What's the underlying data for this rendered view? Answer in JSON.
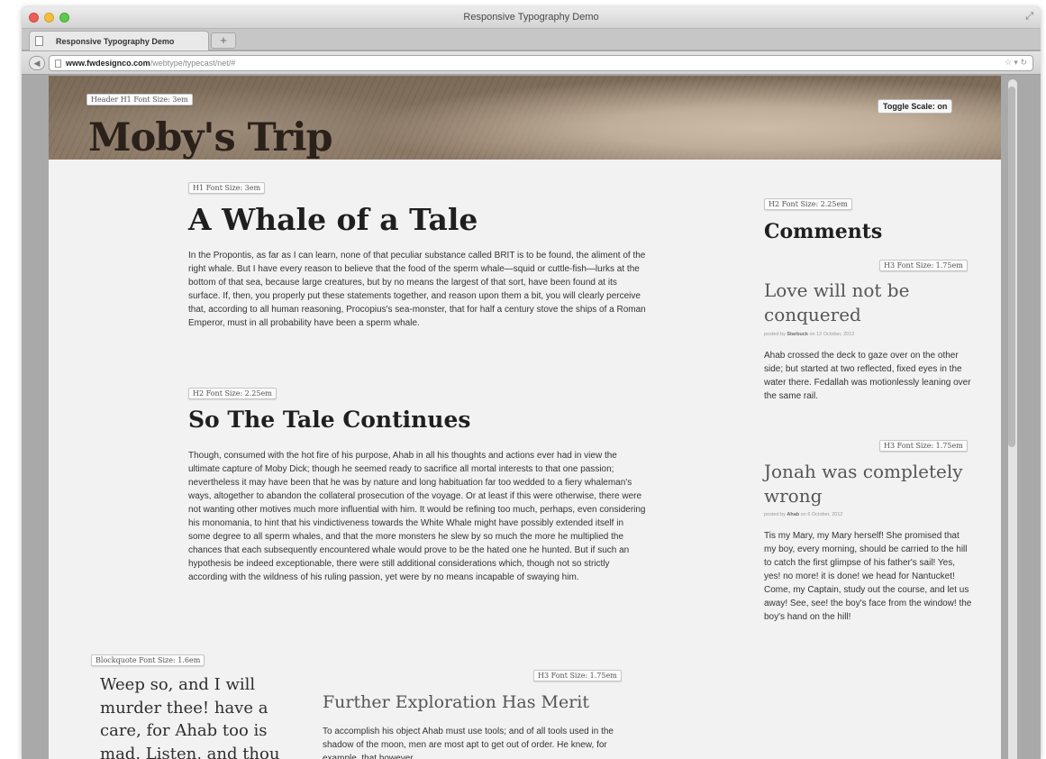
{
  "browser": {
    "window_title": "Responsive Typography Demo",
    "tab_label": "Responsive Typography Demo",
    "new_tab_label": "+",
    "url_domain": "www.fwdesignco.com",
    "url_path": "/webtype/typecast/net/#"
  },
  "header": {
    "title": "Moby's Trip",
    "size_label": "Header H1 Font Size: 3em",
    "toggle_label": "Toggle Scale: on"
  },
  "main": {
    "h1_label": "H1 Font Size: 3em",
    "h1": "A Whale of a Tale",
    "p1": "In the Propontis, as far as I can learn, none of that peculiar substance called BRIT is to be found, the aliment of the right whale. But I have every reason to believe that the food of the sperm whale—squid or cuttle-fish—lurks at the bottom of that sea, because large creatures, but by no means the largest of that sort, have been found at its surface. If, then, you properly put these statements together, and reason upon them a bit, you will clearly perceive that, according to all human reasoning, Procopius's sea-monster, that for half a century stove the ships of a Roman Emperor, must in all probability have been a sperm whale.",
    "h2_label": "H2 Font Size: 2.25em",
    "h2": "So The Tale Continues",
    "p2": "Though, consumed with the hot fire of his purpose, Ahab in all his thoughts and actions ever had in view the ultimate capture of Moby Dick; though he seemed ready to sacrifice all mortal interests to that one passion; nevertheless it may have been that he was by nature and long habituation far too wedded to a fiery whaleman's ways, altogether to abandon the collateral prosecution of the voyage. Or at least if this were otherwise, there were not wanting other motives much more influential with him. It would be refining too much, perhaps, even considering his monomania, to hint that his vindictiveness towards the White Whale might have possibly extended itself in some degree to all sperm whales, and that the more monsters he slew by so much the more he multiplied the chances that each subsequently encountered whale would prove to be the hated one he hunted. But if such an hypothesis be indeed exceptionable, there were still additional considerations which, though not so strictly according with the wildness of his ruling passion, yet were by no means incapable of swaying him.",
    "blockquote_label": "Blockquote Font Size: 1.6em",
    "blockquote": "Weep so, and I will murder thee! have a care, for Ahab too is mad. Listen, and thou",
    "h3_label": "H3 Font Size: 1.75em",
    "h3": "Further Exploration Has Merit",
    "p3": "To accomplish his object Ahab must use tools; and of all tools used in the shadow of the moon, men are most apt to get out of order. He knew, for example, that however"
  },
  "sidebar": {
    "h2_label": "H2 Font Size: 2.25em",
    "h2": "Comments",
    "comments": [
      {
        "label": "H3 Font Size: 1.75em",
        "title": "Love will not be conquered",
        "posted_prefix": "posted by ",
        "author": "Starbuck",
        "posted_suffix": " on 12 October, 2012",
        "body": "Ahab crossed the deck to gaze over on the other side; but started at two reflected, fixed eyes in the water there. Fedallah was motionlessly leaning over the same rail."
      },
      {
        "label": "H3 Font Size: 1.75em",
        "title": "Jonah was completely wrong",
        "posted_prefix": "posted by ",
        "author": "Ahab",
        "posted_suffix": " on 6 October, 2012",
        "body": "Tis my Mary, my Mary herself! She promised that my boy, every morning, should be carried to the hill to catch the first glimpse of his father's sail! Yes, yes! no more! it is done! we head for Nantucket! Come, my Captain, study out the course, and let us away! See, see! the boy's face from the window! the boy's hand on the hill!"
      }
    ]
  }
}
